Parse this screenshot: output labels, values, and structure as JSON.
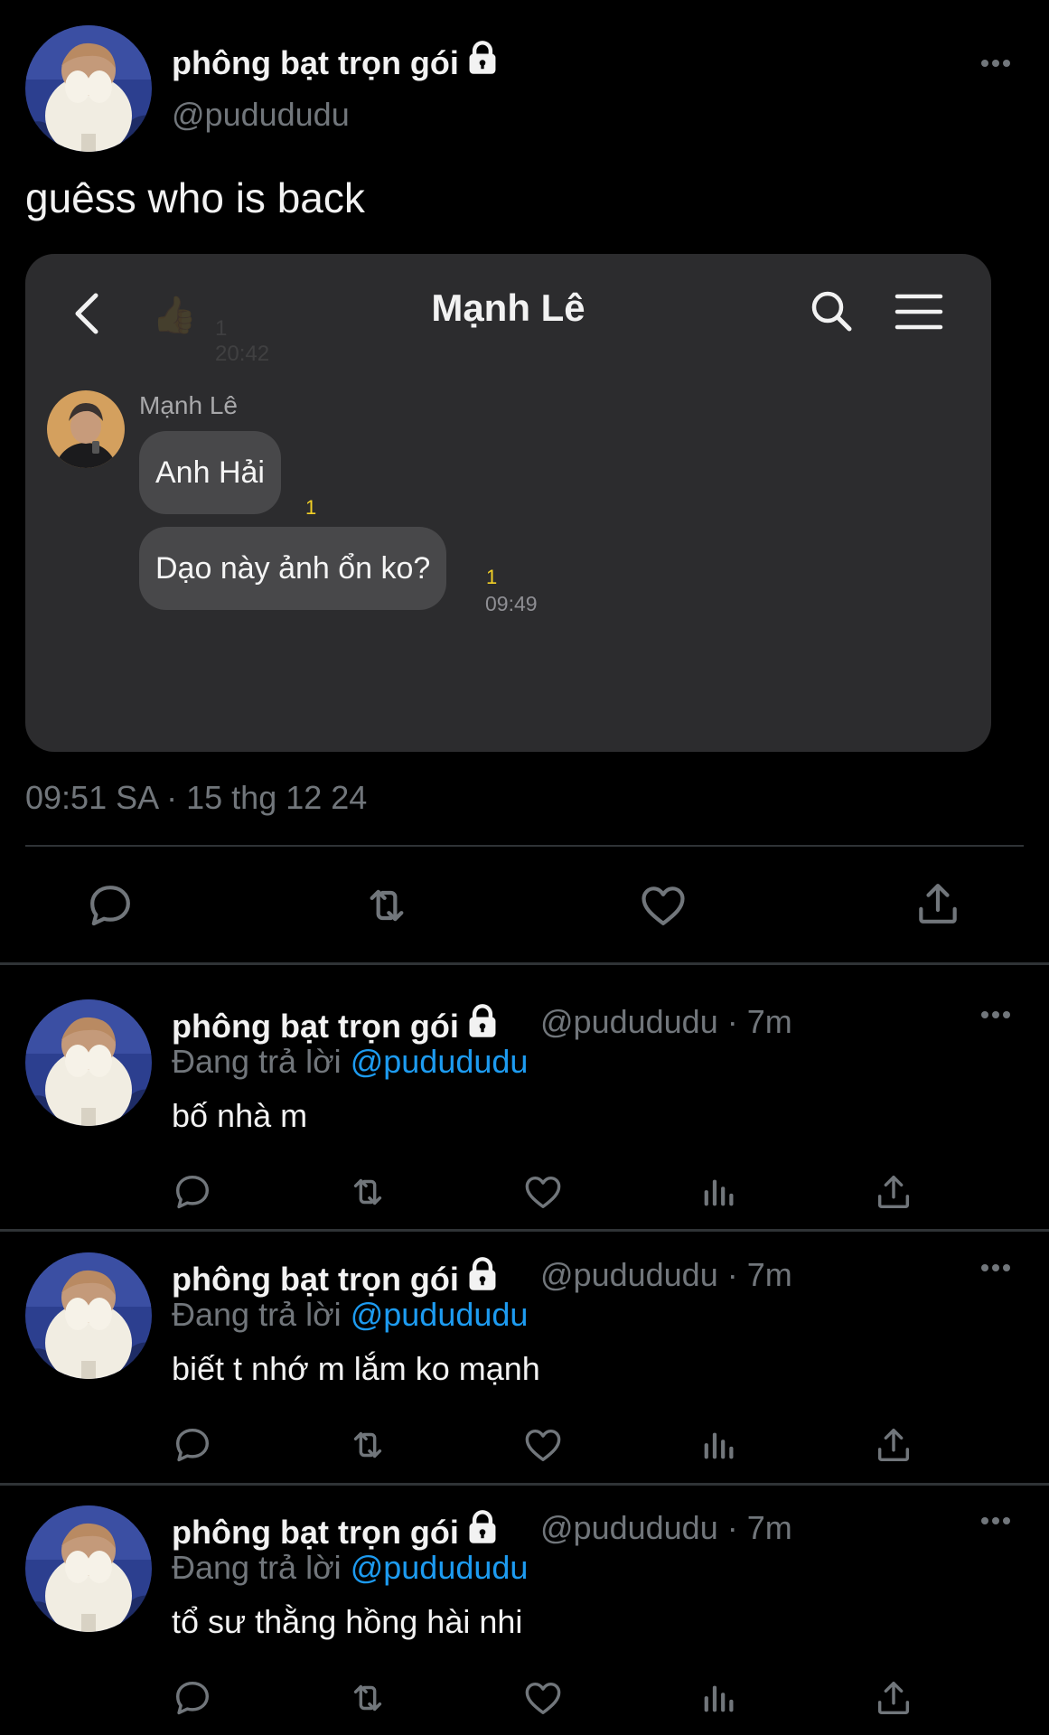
{
  "main_tweet": {
    "display_name": "phông bạt trọn gói",
    "handle": "@pudududu",
    "text": "guêss who is back",
    "timestamp": "09:51 SA · 15 thg 12 24",
    "media": {
      "chat_title": "Mạnh Lê",
      "ghost_count": "1",
      "ghost_time": "20:42",
      "sender_name": "Mạnh Lê",
      "messages": [
        {
          "text": "Anh Hải",
          "unread": "1"
        },
        {
          "text": "Dạo này ảnh ổn ko?",
          "unread": "1",
          "time": "09:49"
        }
      ]
    }
  },
  "replies": [
    {
      "display_name": "phông bạt trọn gói",
      "handle": "@pudududu · 7m",
      "replying_label": "Đang trả lời",
      "replying_to": "@pudududu",
      "text": "bố nhà m"
    },
    {
      "display_name": "phông bạt trọn gói",
      "handle": "@pudududu · 7m",
      "replying_label": "Đang trả lời",
      "replying_to": "@pudududu",
      "text": "biết t nhớ m lắm ko mạnh"
    },
    {
      "display_name": "phông bạt trọn gói",
      "handle": "@pudududu · 7m",
      "replying_label": "Đang trả lời",
      "replying_to": "@pudududu",
      "text": "tổ sư thằng hồng hài nhi"
    }
  ],
  "icons": {
    "lock": "lock-icon",
    "more": "more-icon",
    "reply": "reply-icon",
    "retweet": "retweet-icon",
    "like": "heart-icon",
    "views": "views-icon",
    "share": "share-icon"
  },
  "colors": {
    "background": "#000000",
    "mention": "#1d9bf0",
    "secondary_text": "#71767b",
    "unread_badge": "#f3d026"
  }
}
